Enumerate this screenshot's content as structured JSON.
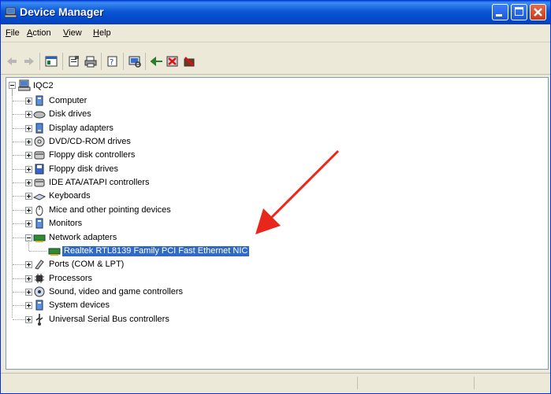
{
  "window": {
    "title": "Device Manager",
    "title_icon": "device-manager-icon"
  },
  "colors": {
    "titlebar": "#0a56d6",
    "selection": "#316ac5",
    "arrow": "#e8261b",
    "close": "#c73b1b"
  },
  "menu": [
    {
      "label": "File",
      "hotkey": "F",
      "rest": "ile"
    },
    {
      "label": "Action",
      "hotkey": "A",
      "rest": "ction"
    },
    {
      "label": "View",
      "hotkey": "V",
      "rest": "iew"
    },
    {
      "label": "Help",
      "hotkey": "H",
      "rest": "elp"
    }
  ],
  "toolbar": [
    "back-icon",
    "forward-icon",
    "console-tree-icon",
    "properties-icon",
    "print-icon",
    "help-icon",
    "scan-hardware-icon",
    "update-driver-icon",
    "uninstall-icon",
    "disable-icon"
  ],
  "tree": {
    "root": "IQC2",
    "categories": [
      {
        "label": "Computer",
        "icon": "computer-icon"
      },
      {
        "label": "Disk drives",
        "icon": "disk-drive-icon"
      },
      {
        "label": "Display adapters",
        "icon": "display-adapter-icon"
      },
      {
        "label": "DVD/CD-ROM drives",
        "icon": "dvd-drive-icon"
      },
      {
        "label": "Floppy disk controllers",
        "icon": "floppy-controller-icon"
      },
      {
        "label": "Floppy disk drives",
        "icon": "floppy-drive-icon"
      },
      {
        "label": "IDE ATA/ATAPI controllers",
        "icon": "ide-controller-icon"
      },
      {
        "label": "Keyboards",
        "icon": "keyboard-icon"
      },
      {
        "label": "Mice and other pointing devices",
        "icon": "mouse-icon"
      },
      {
        "label": "Monitors",
        "icon": "monitor-icon"
      },
      {
        "label": "Network adapters",
        "icon": "network-adapter-icon",
        "expanded": true,
        "children": [
          {
            "label": "Realtek RTL8139 Family PCI Fast Ethernet NIC",
            "icon": "network-card-icon",
            "selected": true
          }
        ]
      },
      {
        "label": "Ports (COM & LPT)",
        "icon": "port-icon"
      },
      {
        "label": "Processors",
        "icon": "processor-icon"
      },
      {
        "label": "Sound, video and game controllers",
        "icon": "sound-icon"
      },
      {
        "label": "System devices",
        "icon": "system-device-icon"
      },
      {
        "label": "Universal Serial Bus controllers",
        "icon": "usb-icon"
      }
    ]
  }
}
